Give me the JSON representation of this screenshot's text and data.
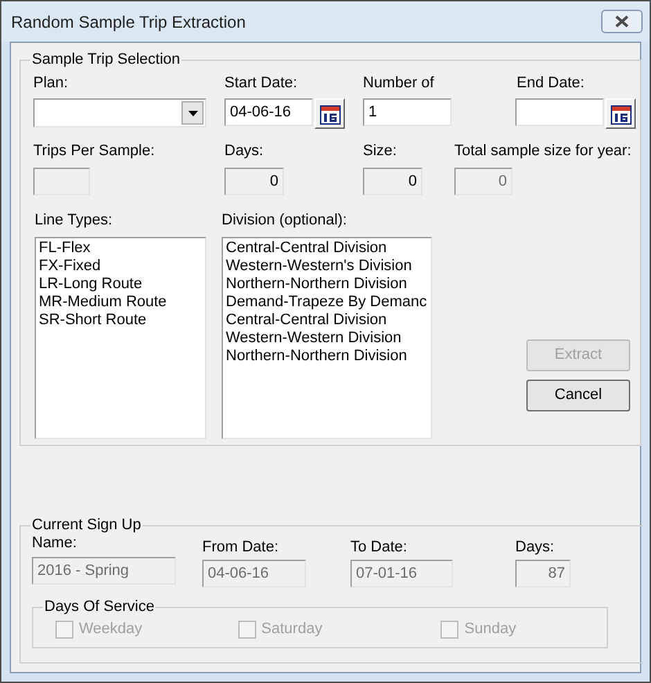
{
  "window": {
    "title": "Random Sample Trip Extraction"
  },
  "sample_trip_selection": {
    "title": "Sample Trip Selection",
    "plan": {
      "label": "Plan:"
    },
    "start_date": {
      "label": "Start Date:",
      "value": "04-06-16"
    },
    "number_of": {
      "label": "Number of",
      "value": "1"
    },
    "end_date": {
      "label": "End Date:"
    },
    "trips_per_sample": {
      "label": "Trips Per Sample:"
    },
    "days": {
      "label": "Days:",
      "value": "0",
      "disabled": false
    },
    "size": {
      "label": "Size:",
      "value": "0",
      "disabled": false
    },
    "total_sample_size": {
      "label": "Total sample size for year:",
      "value": "0",
      "disabled": true
    },
    "line_types": {
      "label": "Line Types:",
      "items": [
        "FL-Flex",
        "FX-Fixed",
        "LR-Long Route",
        "MR-Medium Route",
        "SR-Short Route"
      ]
    },
    "division": {
      "label": "Division (optional):",
      "items": [
        "Central-Central Division",
        "Western-Western's Division",
        "Northern-Northern Division",
        "Demand-Trapeze By Demanc",
        "Central-Central Division",
        "Western-Western Division",
        "Northern-Northern Division"
      ]
    },
    "buttons": [
      {
        "label": "Extract",
        "disabled": true
      },
      {
        "label": "Cancel",
        "disabled": false
      }
    ]
  },
  "current_sign_up": {
    "title": "Current Sign Up",
    "fields": [
      {
        "label": "Name:",
        "value": "2016 - Spring",
        "disabled": true
      },
      {
        "label": "From Date:",
        "value": "04-06-16",
        "disabled": true
      },
      {
        "label": "To Date:",
        "value": "07-01-16",
        "disabled": true
      },
      {
        "label": "Days:",
        "value": "87",
        "disabled": true
      }
    ],
    "days_of_service": {
      "title": "Days Of Service",
      "options": [
        {
          "label": "Weekday",
          "checked": false,
          "disabled": true
        },
        {
          "label": "Saturday",
          "checked": false,
          "disabled": true
        },
        {
          "label": "Sunday",
          "checked": false,
          "disabled": true
        }
      ]
    }
  }
}
